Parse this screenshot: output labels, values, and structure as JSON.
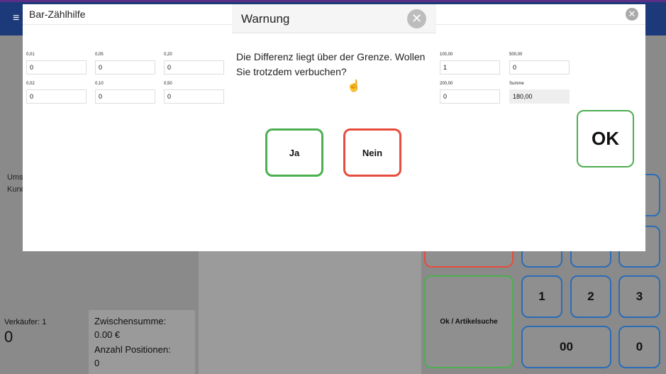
{
  "app": {
    "menu_icon": "hamburger-icon"
  },
  "background": {
    "left_labels": [
      "Ums",
      "Kund"
    ],
    "seller_label": "Verkäufer: 1",
    "seller_value": "0",
    "subtotal_label": "Zwischensumme:",
    "subtotal_value": "0.00 €",
    "positions_label": "Anzahl Positionen:",
    "positions_value": "0",
    "search_button": "Ok / Artikelsuche",
    "keys": {
      "k1": "1",
      "k2": "2",
      "k3": "3",
      "k00": "00",
      "k0": "0"
    }
  },
  "modal": {
    "title": "Bar-Zählhilfe",
    "ok_label": "OK",
    "fields": [
      {
        "label": "0,01",
        "value": "0"
      },
      {
        "label": "0,05",
        "value": "0"
      },
      {
        "label": "0,20",
        "value": "0"
      },
      {
        "label": "0,02",
        "value": "0"
      },
      {
        "label": "0,10",
        "value": "0"
      },
      {
        "label": "0,50",
        "value": "0"
      },
      {
        "label": "100,00",
        "value": "1"
      },
      {
        "label": "500,00",
        "value": "0"
      },
      {
        "label": "200,00",
        "value": "0"
      },
      {
        "label": "Summe",
        "value": "180,00"
      }
    ]
  },
  "dialog": {
    "title": "Warnung",
    "message": "Die Differenz liegt über der Grenze. Wollen Sie trotzdem verbuchen?",
    "yes_label": "Ja",
    "no_label": "Nein"
  }
}
